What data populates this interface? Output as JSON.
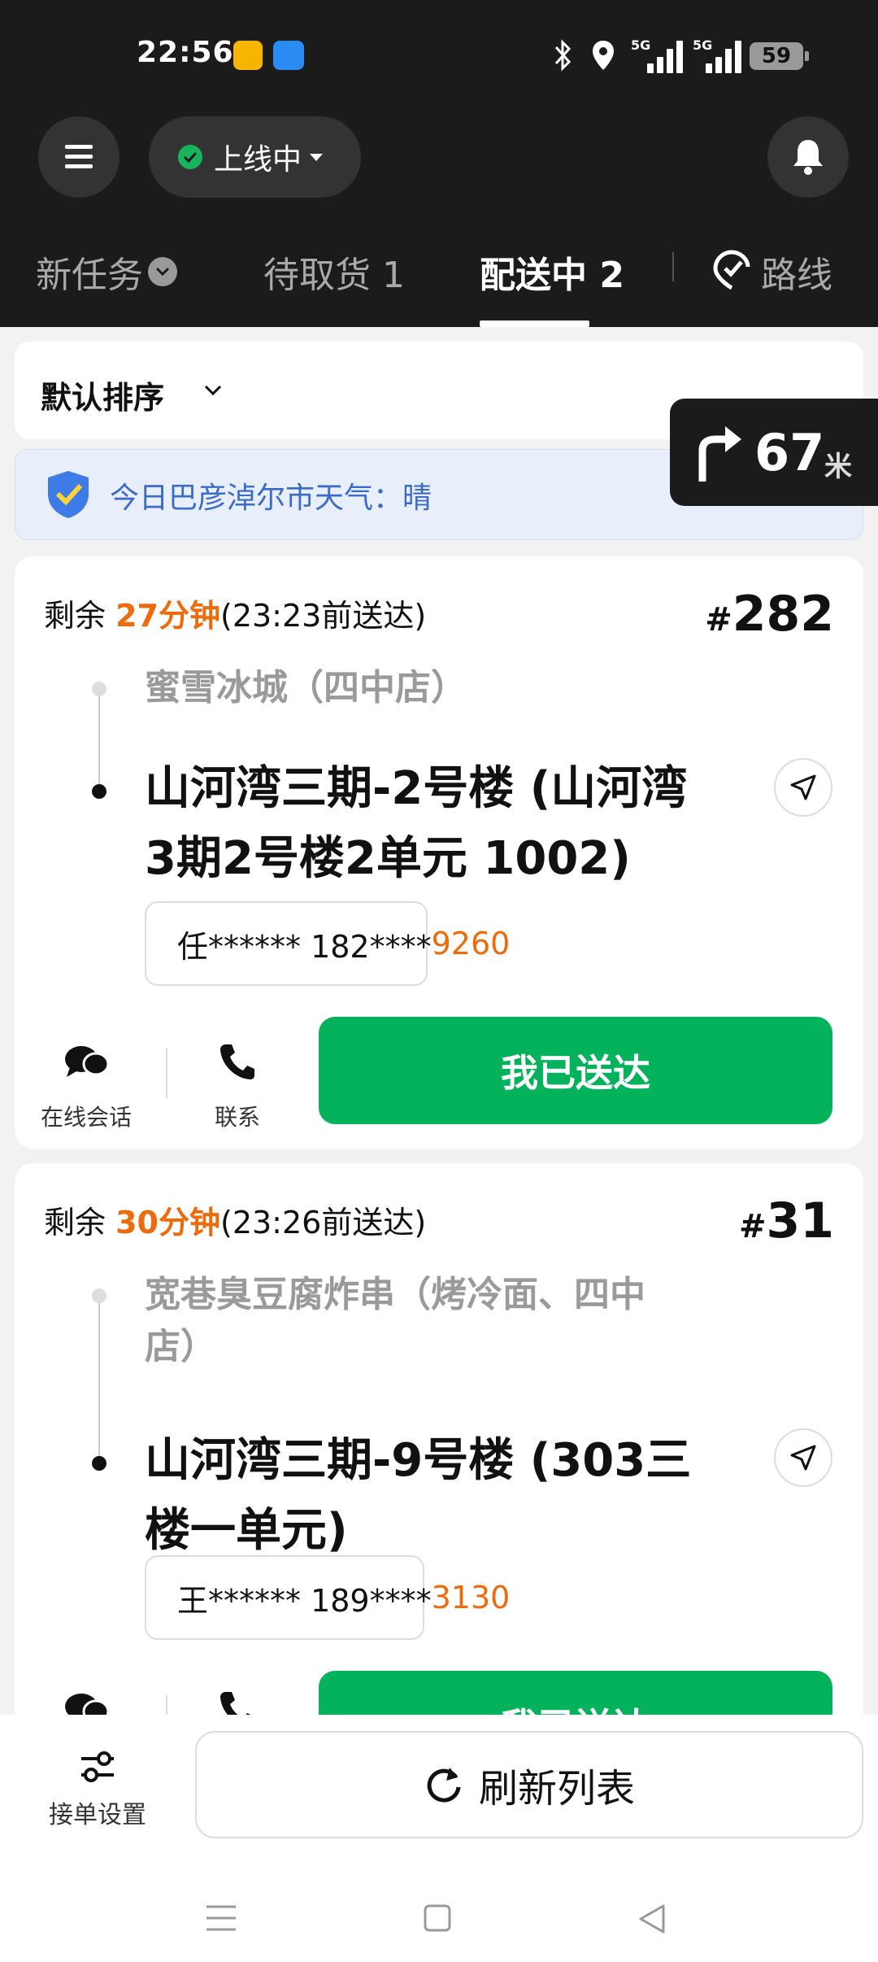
{
  "status_bar": {
    "time": "22:56",
    "network1": "5G",
    "network2": "5G",
    "battery": "59"
  },
  "header": {
    "online_label": "上线中"
  },
  "tabs": [
    {
      "label": "新任务"
    },
    {
      "label": "待取货 1"
    },
    {
      "label": "配送中 2"
    },
    {
      "label": "路线"
    }
  ],
  "sort": {
    "label": "默认排序"
  },
  "nav_hint": {
    "distance": "67",
    "unit": "米"
  },
  "weather": {
    "text": "今日巴彦淖尔市天气：晴"
  },
  "orders": [
    {
      "remain_prefix": "剩余",
      "remain_time": "27分钟",
      "deadline": "(23:23前送达)",
      "number": "282",
      "shop": "蜜雪冰城（四中店）",
      "address_line1": "山河湾三期-2号楼 (山河湾",
      "address_line2": "3期2号楼2单元 1002)",
      "customer": "任****** 182****",
      "phone_tail": "9260",
      "chat_label": "在线会话",
      "contact_label": "联系",
      "deliver_label": "我已送达"
    },
    {
      "remain_prefix": "剩余",
      "remain_time": "30分钟",
      "deadline": "(23:26前送达)",
      "number": "31",
      "shop_line1": "宽巷臭豆腐炸串（烤冷面、四中",
      "shop_line2": "店）",
      "address_line1": "山河湾三期-9号楼 (303三",
      "address_line2": "楼一单元)",
      "customer": "王****** 189****",
      "phone_tail": "3130",
      "deliver_label": "我已送达"
    }
  ],
  "bottom": {
    "settings_label": "接单设置",
    "refresh_label": "刷新列表"
  }
}
